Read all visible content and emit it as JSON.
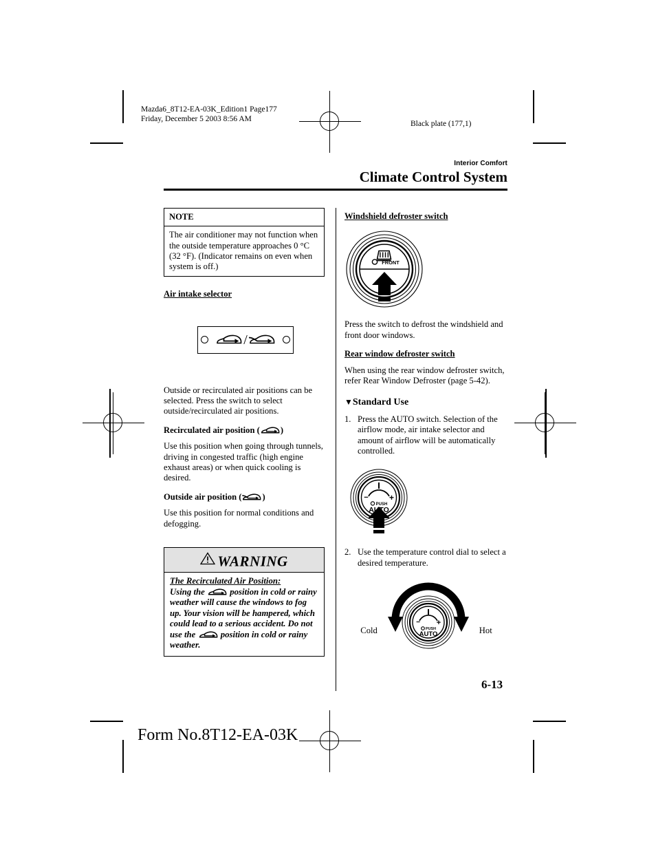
{
  "printer": {
    "job_info_line1": "Mazda6_8T12-EA-03K_Edition1 Page177",
    "job_info_line2": "Friday, December 5 2003 8:56 AM",
    "black_plate": "Black plate (177,1)"
  },
  "header": {
    "section_label": "Interior Comfort",
    "chapter_title": "Climate Control System"
  },
  "note": {
    "title": "NOTE",
    "body": "The air conditioner may not function when the outside temperature approaches 0 °C (32 °F). (Indicator remains on even when system is off.)"
  },
  "left_column": {
    "air_intake_heading": "Air intake selector",
    "intro": "Outside or recirculated air positions can be selected. Press the switch to select outside/recirculated air positions.",
    "recirc_heading_prefix": "Recirculated air position (",
    "recirc_heading_suffix": ")",
    "recirc_body": "Use this position when going through tunnels, driving in congested traffic (high engine exhaust areas) or when quick cooling is desired.",
    "outside_heading_prefix": "Outside air position (",
    "outside_heading_suffix": ")",
    "outside_body": "Use this position for normal conditions and defogging."
  },
  "warning": {
    "title": "WARNING",
    "underlined_lead": "The Recirculated Air Position:",
    "text_part1": "Using the ",
    "text_part2": " position in cold or rainy weather will cause the windows to fog up. Your vision will be hampered, which could lead to a serious accident. Do not use the ",
    "text_part3": " position in cold or rainy weather."
  },
  "right_column": {
    "windshield_heading": "Windshield defroster switch",
    "windshield_body": "Press the switch to defrost the windshield and front door windows.",
    "rear_heading": "Rear window defroster switch",
    "rear_body": "When using the rear window defroster switch, refer Rear Window Defroster (page 5-42).",
    "standard_use_heading": "Standard Use",
    "standard_use_marker": "▼",
    "steps": [
      {
        "num": "1.",
        "text": "Press the AUTO switch. Selection of the airflow mode, air intake selector and amount of airflow will be automatically controlled."
      },
      {
        "num": "2.",
        "text": "Use the temperature control dial to select a desired temperature."
      }
    ],
    "temp_dial_left_label": "Cold",
    "temp_dial_right_label": "Hot"
  },
  "figures": {
    "defroster_switch": {
      "indicator_label": "FRONT",
      "icon": "windshield-defrost-icon"
    },
    "auto_dial": {
      "minus_label": "−",
      "plus_label": "+",
      "push_label": "PUSH",
      "auto_label": "AUTO"
    }
  },
  "footer": {
    "page_number": "6-13",
    "form_number": "Form No.8T12-EA-03K"
  },
  "colors": {
    "ink": "#000000",
    "warning_header_bg": "#e2e2e2",
    "paper": "#ffffff"
  }
}
